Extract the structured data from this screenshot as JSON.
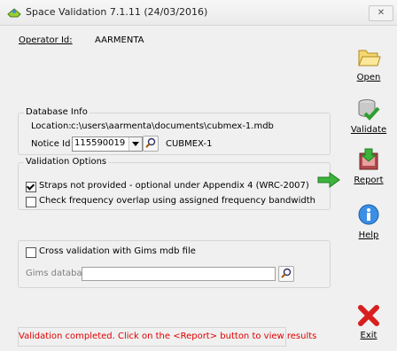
{
  "window": {
    "title": "Space Validation 7.1.11 (24/03/2016)",
    "close_glyph": "✕"
  },
  "operator": {
    "label": "Operator Id:",
    "value": "AARMENTA"
  },
  "database_info": {
    "legend": "Database Info",
    "location_label": "Location:",
    "location_value": "c:\\users\\aarmenta\\documents\\cubmex-1.mdb",
    "notice_label": "Notice Id",
    "notice_value": "115590019",
    "notice_name": "CUBMEX-1"
  },
  "validation_options": {
    "legend": "Validation Options",
    "options": [
      {
        "label": "Straps not provided - optional under Appendix 4 (WRC-2007)",
        "checked": true
      },
      {
        "label": "Check frequency overlap using assigned frequency bandwidth",
        "checked": false
      }
    ]
  },
  "cross_validation": {
    "label": "Cross validation with Gims mdb file",
    "checked": false,
    "db_label": "Gims database:",
    "db_value": ""
  },
  "status": {
    "message": "Validation completed. Click on the <Report> button to view results",
    "color": "#e00000"
  },
  "toolbar": {
    "open": "Open",
    "validate": "Validate",
    "report": "Report",
    "help": "Help",
    "exit": "Exit"
  },
  "icons": {
    "open": "folder-icon",
    "validate": "database-check-icon",
    "report": "report-icon",
    "help": "info-icon",
    "exit": "red-x-icon",
    "arrow": "green-arrow-icon"
  }
}
